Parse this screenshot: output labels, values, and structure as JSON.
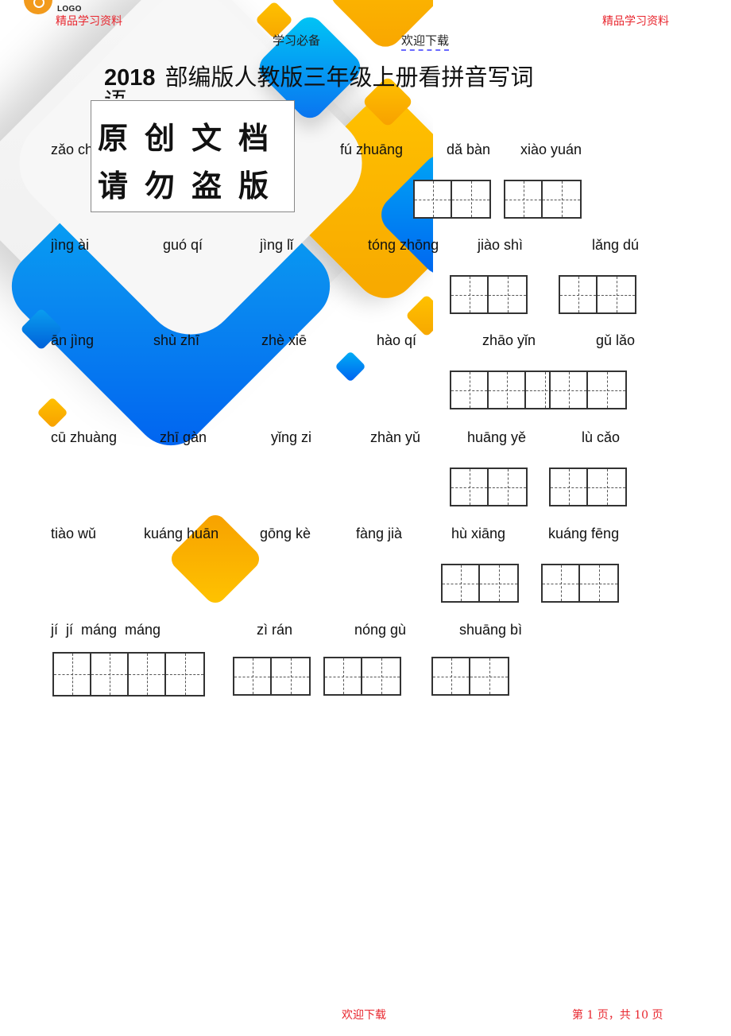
{
  "logo": {
    "text": "LOGO"
  },
  "header": {
    "left_label": "精品学习资料",
    "right_label": "精品学习资料",
    "center_left": "学习必备",
    "center_right": "欢迎下载"
  },
  "title": {
    "year": "2018",
    "text": "部编版人教版三年级上册看拼音写词",
    "overflow": "语"
  },
  "stamp": {
    "line1": "原创文档",
    "line2": "请勿盗版"
  },
  "rows": [
    {
      "items": [
        {
          "pinyin": "zǎo chén",
          "boxes": 0
        },
        {
          "pinyin": "fú zhuāng",
          "boxes": 2
        },
        {
          "pinyin": "dǎ bàn",
          "boxes": 2
        },
        {
          "pinyin": "xiào yuán",
          "boxes": 2
        }
      ]
    },
    {
      "items": [
        {
          "pinyin": "jìng ài",
          "boxes": 0
        },
        {
          "pinyin": "guó qí",
          "boxes": 0
        },
        {
          "pinyin": "jìng lǐ",
          "boxes": 0
        },
        {
          "pinyin": "tóng zhōng",
          "boxes": 0
        },
        {
          "pinyin": "jiào shì",
          "boxes": 2
        },
        {
          "pinyin": "lǎng dú",
          "boxes": 2
        }
      ]
    },
    {
      "items": [
        {
          "pinyin": "ān jìng",
          "boxes": 0
        },
        {
          "pinyin": "shù zhī",
          "boxes": 0
        },
        {
          "pinyin": "zhè xiē",
          "boxes": 0
        },
        {
          "pinyin": "hào qí",
          "boxes": 0
        },
        {
          "pinyin": "zhāo yǐn",
          "boxes": 3
        },
        {
          "pinyin": "gǔ lǎo",
          "boxes": 2
        }
      ]
    },
    {
      "items": [
        {
          "pinyin": "cū zhuàng",
          "boxes": 0
        },
        {
          "pinyin": "zhī gàn",
          "boxes": 0
        },
        {
          "pinyin": "yǐng zi",
          "boxes": 0
        },
        {
          "pinyin": "zhàn yǔ",
          "boxes": 0
        },
        {
          "pinyin": "huāng yě",
          "boxes": 2
        },
        {
          "pinyin": "lù cǎo",
          "boxes": 2
        }
      ]
    },
    {
      "items": [
        {
          "pinyin": "tiào wǔ",
          "boxes": 0
        },
        {
          "pinyin": "kuáng huān",
          "boxes": 0
        },
        {
          "pinyin": "gōng kè",
          "boxes": 0
        },
        {
          "pinyin": "fàng jià",
          "boxes": 0
        },
        {
          "pinyin": "hù xiāng",
          "boxes": 2
        },
        {
          "pinyin": "kuáng fēng",
          "boxes": 2
        }
      ]
    },
    {
      "items": [
        {
          "pinyin": "jí  jí  máng  máng",
          "boxes": 4
        },
        {
          "pinyin": "zì rán",
          "boxes": 2
        },
        {
          "pinyin": "nóng gù",
          "boxes": 2
        },
        {
          "pinyin": "shuāng bì",
          "boxes": 2
        }
      ]
    }
  ],
  "footer": {
    "center": "欢迎下载",
    "page_info": "第 1 页，共 10 页"
  }
}
